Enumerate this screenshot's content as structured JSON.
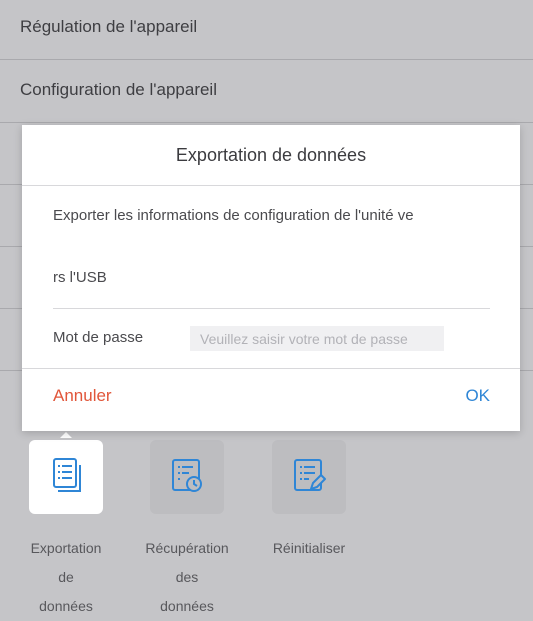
{
  "background_menu": {
    "items": [
      {
        "label": "Régulation de l'appareil"
      },
      {
        "label": "Configuration de l'appareil"
      }
    ]
  },
  "dialog": {
    "title": "Exportation de données",
    "message_line1": "Exporter les informations de configuration de l'unité ve",
    "message_line2": "rs l'USB",
    "password_label": "Mot de passe",
    "password_placeholder": "Veuillez saisir votre mot de passe",
    "cancel_label": "Annuler",
    "ok_label": "OK"
  },
  "tiles": [
    {
      "label_lines": [
        "Exportation",
        "de",
        "données"
      ],
      "icon": "document-list-icon",
      "active": true
    },
    {
      "label_lines": [
        "Récupération",
        "des",
        "données"
      ],
      "icon": "document-restore-icon",
      "active": false
    },
    {
      "label_lines": [
        "Réinitialiser"
      ],
      "icon": "document-edit-icon",
      "active": false
    }
  ],
  "colors": {
    "cancel": "#e1563a",
    "ok": "#2f86d6",
    "icon": "#2f86d6",
    "icon_inactive": "#8a8a90"
  }
}
